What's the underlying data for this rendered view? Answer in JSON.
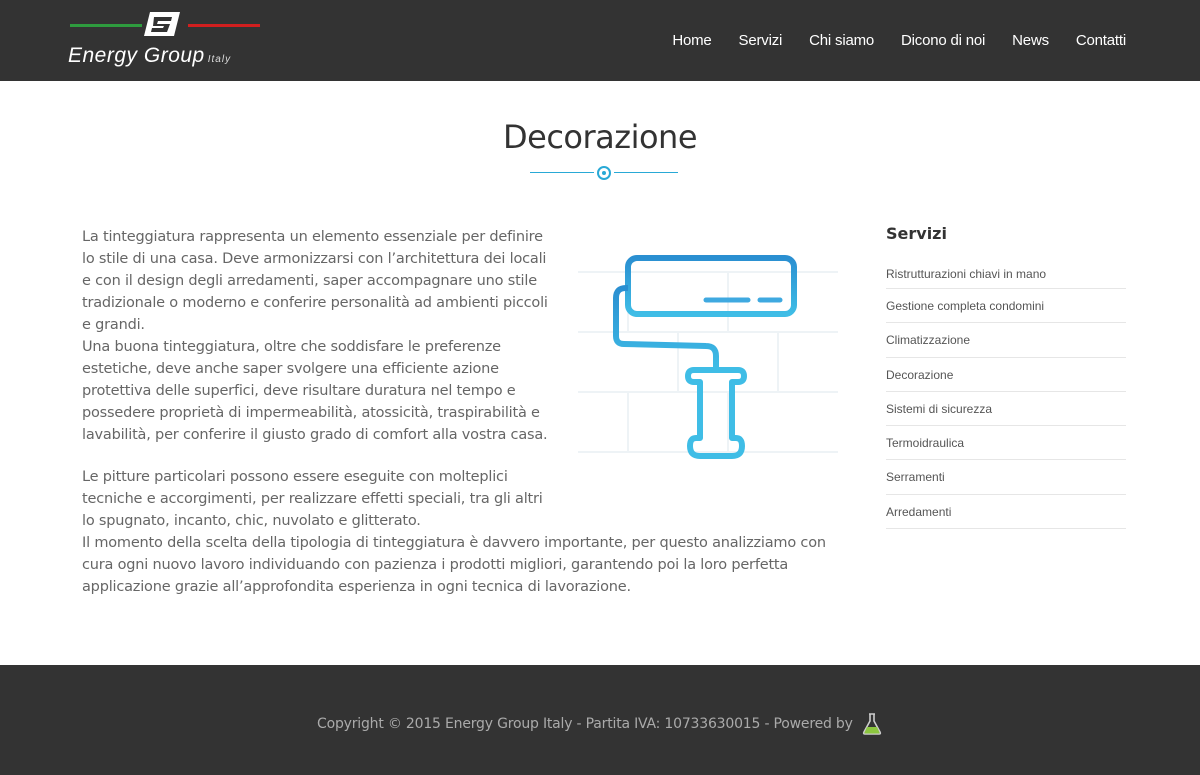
{
  "header": {
    "logo": {
      "name_main": "Energy Group",
      "name_suffix": "Italy",
      "colors": {
        "green": "#2e9b3e",
        "red": "#d11f1f",
        "white": "#ffffff"
      }
    },
    "nav": [
      {
        "label": "Home"
      },
      {
        "label": "Servizi"
      },
      {
        "label": "Chi siamo"
      },
      {
        "label": "Dicono di noi"
      },
      {
        "label": "News"
      },
      {
        "label": "Contatti"
      }
    ],
    "background": "#333333"
  },
  "page": {
    "title": "Decorazione",
    "accent_color": "#29a9d6",
    "illustration_icon": "paint-roller-icon",
    "paragraphs": [
      "La tinteggiatura rappresenta un elemento essenziale per definire lo stile di una casa. Deve armonizzarsi con l’architettura dei locali e con il design degli arredamenti, saper accompagnare uno stile tradizionale o moderno e conferire personalità ad ambienti piccoli e grandi.",
      "Una buona tinteggiatura, oltre che soddisfare le preferenze estetiche, deve anche saper svolgere una efficiente azione protettiva delle superfici, deve risultare duratura nel tempo e possedere proprietà di impermeabilità, atossicità, traspirabilità e lavabilità, per conferire il giusto grado di comfort alla vostra casa.",
      "Le pitture particolari possono essere eseguite con molteplici tecniche e accorgimenti, per realizzare effetti speciali, tra gli altri lo spugnato, incanto, chic, nuvolato e glitterato.",
      "Il momento della scelta della tipologia di tinteggiatura è davvero importante, per questo analizziamo con cura ogni nuovo lavoro individuando con pazienza i prodotti migliori, garantendo poi la loro perfetta applicazione grazie all’approfondita esperienza in ogni tecnica di lavorazione."
    ]
  },
  "sidebar": {
    "title": "Servizi",
    "items": [
      {
        "label": "Ristrutturazioni chiavi in mano"
      },
      {
        "label": "Gestione completa condomini"
      },
      {
        "label": "Climatizzazione"
      },
      {
        "label": "Decorazione"
      },
      {
        "label": "Sistemi di sicurezza"
      },
      {
        "label": "Termoidraulica"
      },
      {
        "label": "Serramenti"
      },
      {
        "label": "Arredamenti"
      }
    ]
  },
  "footer": {
    "text": "Copyright © 2015 Energy Group Italy - Partita IVA: 10733630015 - Powered by",
    "powered_icon": "flask-icon",
    "background": "#333333"
  }
}
